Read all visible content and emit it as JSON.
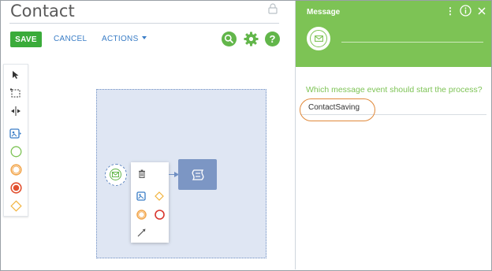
{
  "page": {
    "title": "Contact"
  },
  "toolbar": {
    "save_label": "SAVE",
    "cancel_label": "CANCEL",
    "actions_label": "ACTIONS"
  },
  "icons": {
    "search": "search-icon",
    "settings": "gear-icon",
    "help": "help-icon",
    "lock": "lock-icon"
  },
  "palette": {
    "items": [
      "pointer-icon",
      "lasso-select-icon",
      "space-tool-icon",
      "subprocess-icon",
      "start-event-icon",
      "intermediate-event-icon",
      "end-event-icon",
      "gateway-icon"
    ]
  },
  "diagram": {
    "context_menu": [
      "delete-icon",
      "subprocess-icon",
      "gateway-icon",
      "intermediate-event-icon",
      "end-event-icon",
      "connector-icon"
    ]
  },
  "panel": {
    "title": "Message",
    "question": "Which message event should start the process?",
    "message_value": "ContactSaving"
  },
  "colors": {
    "accent_green": "#7dc355",
    "save_green": "#3aab3a",
    "link_blue": "#3a7dc6",
    "highlight_orange": "#e0893a",
    "task_blue": "#7c96c4"
  }
}
